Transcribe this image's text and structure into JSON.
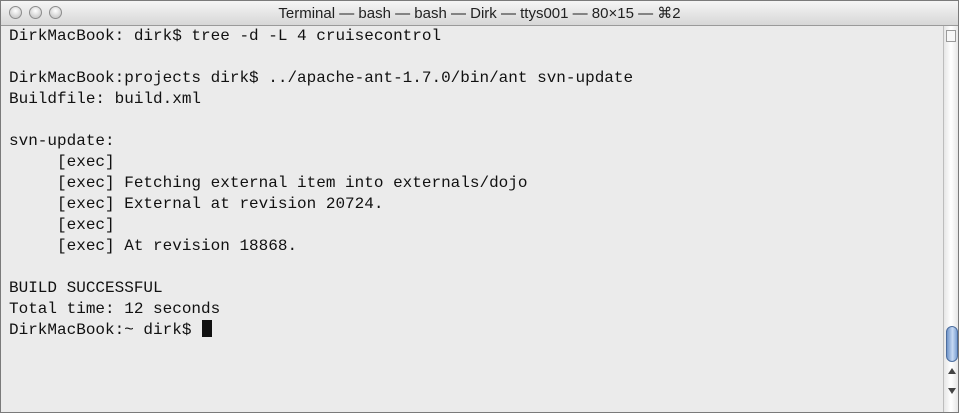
{
  "window": {
    "title": "Terminal — bash — bash — Dirk — ttys001 — 80×15 — ⌘2"
  },
  "terminal": {
    "lines": [
      "DirkMacBook: dirk$ tree -d -L 4 cruisecontrol",
      "",
      "DirkMacBook:projects dirk$ ../apache-ant-1.7.0/bin/ant svn-update",
      "Buildfile: build.xml",
      "",
      "svn-update:",
      "     [exec]",
      "     [exec] Fetching external item into externals/dojo",
      "     [exec] External at revision 20724.",
      "     [exec]",
      "     [exec] At revision 18868.",
      "",
      "BUILD SUCCESSFUL",
      "Total time: 12 seconds",
      "DirkMacBook:~ dirk$ "
    ]
  },
  "icons": {
    "traffic_lights": [
      "close-button-icon",
      "minimize-button-icon",
      "zoom-button-icon"
    ],
    "cursor": "block-cursor-icon",
    "scroll": [
      "scroll-up-arrow-icon",
      "scroll-down-arrow-icon"
    ]
  }
}
